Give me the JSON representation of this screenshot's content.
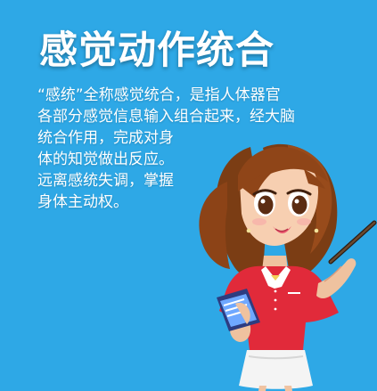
{
  "title": "感觉动作统合",
  "body_lines": [
    "“感统”全称感觉统合，是指人体器官",
    "各部分感觉信息输入组合起来，经大脑",
    "统合作用，完成对身",
    "体的知觉做出反应。",
    "远离感统失调，掌握",
    "身体主动权。"
  ],
  "colors": {
    "background": "#2EA8E6",
    "text": "#FFFFFF"
  },
  "illustration": {
    "subject": "teacher-character",
    "icons": [
      "hair-icon",
      "face-icon",
      "book-icon",
      "pointer-stick-icon"
    ]
  }
}
